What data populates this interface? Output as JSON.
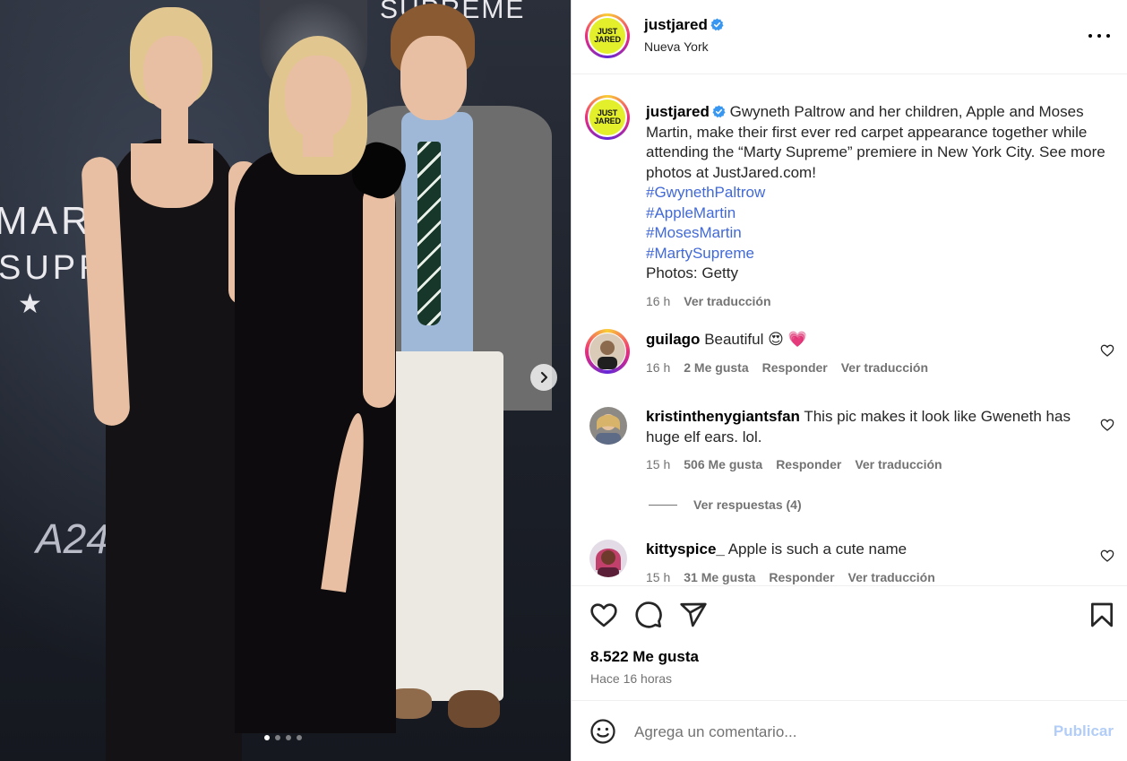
{
  "post": {
    "account": {
      "username": "justjared",
      "location": "Nueva York",
      "logo_text_line1": "JUST",
      "logo_text_line2": "JARED",
      "verified_color": "#3897f0"
    },
    "photo": {
      "poster_top_text": "SUPREME",
      "poster_marty": "MARTY",
      "poster_supreme": "SUPREME",
      "poster_stars": "★ ★",
      "poster_brand": "A24",
      "carousel_count": 4,
      "carousel_active_index": 0
    },
    "caption": {
      "username": "justjared",
      "text": "Gwyneth Paltrow and her children, Apple and Moses Martin, make their first ever red carpet appearance together while attending the “Marty Supreme” premiere in New York City. See more photos at JustJared.com!",
      "hashtags": [
        "#GwynethPaltrow",
        "#AppleMartin",
        "#MosesMartin",
        "#MartySupreme"
      ],
      "credit": "Photos: Getty",
      "time": "16 h",
      "translate_label": "Ver traducción"
    },
    "comments": [
      {
        "username": "guilago",
        "text": "Beautiful",
        "emojis": "😍 💗",
        "time": "16 h",
        "likes": "2 Me gusta",
        "reply_label": "Responder",
        "translate_label": "Ver traducción"
      },
      {
        "username": "kristinthenygiantsfan",
        "text": "This pic makes it look like Gweneth has huge elf ears. lol.",
        "time": "15 h",
        "likes": "506 Me gusta",
        "reply_label": "Responder",
        "translate_label": "Ver traducción",
        "view_replies": "Ver respuestas (4)"
      },
      {
        "username": "kittyspice_",
        "text": "Apple is such a cute name",
        "time": "15 h",
        "likes": "31 Me gusta",
        "reply_label": "Responder",
        "translate_label": "Ver traducción"
      }
    ],
    "stats": {
      "likes": "8.522 Me gusta",
      "posted": "Hace 16 horas"
    },
    "composer": {
      "placeholder": "Agrega un comentario...",
      "publish_label": "Publicar",
      "publish_color": "#b2cdf7"
    }
  }
}
